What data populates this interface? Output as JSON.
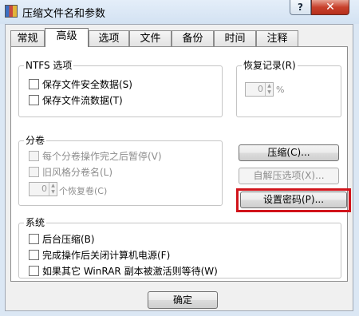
{
  "window": {
    "title": "压缩文件名和参数",
    "help": "?",
    "close": "✕"
  },
  "tabs": [
    "常规",
    "高级",
    "选项",
    "文件",
    "备份",
    "时间",
    "注释"
  ],
  "ntfs": {
    "title": "NTFS 选项",
    "items": [
      "保存文件安全数据(S)",
      "保存文件流数据(T)"
    ]
  },
  "recovery": {
    "title": "恢复记录(R)",
    "value": "0",
    "unit": "%"
  },
  "volume": {
    "title": "分卷",
    "items": [
      "每个分卷操作完之后暂停(V)",
      "旧风格分卷名(L)"
    ],
    "spin_value": "0",
    "spin_label": "个恢复卷(C)"
  },
  "buttons": {
    "compress": "压缩(C)...",
    "sfx": "自解压选项(X)...",
    "password": "设置密码(P)..."
  },
  "system": {
    "title": "系统",
    "items": [
      "后台压缩(B)",
      "完成操作后关闭计算机电源(F)",
      "如果其它 WinRAR 副本被激活则等待(W)"
    ]
  },
  "footer": {
    "ok": "确定"
  },
  "colors": {
    "highlight": "#d1141b",
    "titlebar": "#dbe7f4",
    "close": "#c8412c"
  }
}
